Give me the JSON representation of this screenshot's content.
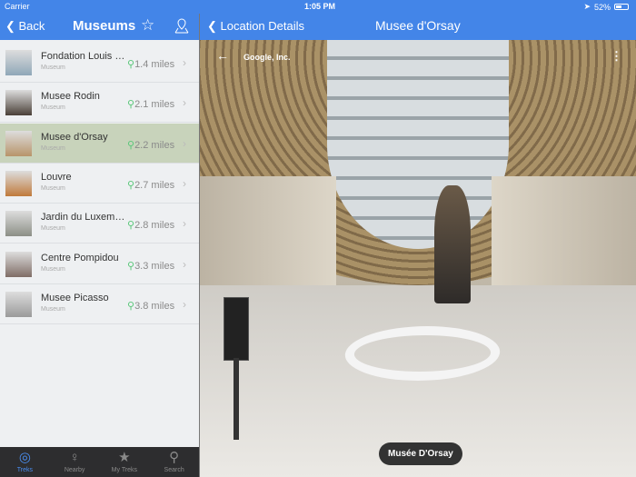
{
  "status": {
    "carrier": "Carrier",
    "time": "1:05 PM",
    "battery": "52%",
    "battery_level": 0.52
  },
  "left_nav": {
    "back": "Back",
    "title": "Museums"
  },
  "museums": [
    {
      "name": "Fondation Louis V...",
      "type": "Museum",
      "distance": "1.4 miles",
      "thumb": "#8fa7b8"
    },
    {
      "name": "Musee Rodin",
      "type": "Museum",
      "distance": "2.1 miles",
      "thumb": "#4a4038"
    },
    {
      "name": "Musee d'Orsay",
      "type": "Museum",
      "distance": "2.2 miles",
      "thumb": "#b8946a",
      "selected": true
    },
    {
      "name": "Louvre",
      "type": "Museum",
      "distance": "2.7 miles",
      "thumb": "#c07a3c"
    },
    {
      "name": "Jardin du Luxemb...",
      "type": "Museum",
      "distance": "2.8 miles",
      "thumb": "#8c8f86"
    },
    {
      "name": "Centre Pompidou",
      "type": "Museum",
      "distance": "3.3 miles",
      "thumb": "#7f6d66"
    },
    {
      "name": "Musee Picasso",
      "type": "Museum",
      "distance": "3.8 miles",
      "thumb": "#9a9a9a"
    }
  ],
  "tabs": [
    {
      "label": "Treks",
      "icon": "treks-icon",
      "active": true
    },
    {
      "label": "Nearby",
      "icon": "pin-icon"
    },
    {
      "label": "My Treks",
      "icon": "star-icon"
    },
    {
      "label": "Search",
      "icon": "search-icon"
    }
  ],
  "right_nav": {
    "back": "Location Details",
    "title": "Musee d'Orsay"
  },
  "streetview": {
    "attribution": "Google, Inc.",
    "place_label": "Musée D'Orsay"
  },
  "colors": {
    "accent": "#4385e8",
    "selected_row": "#c8d3bb",
    "distance_pin": "#5ac77a"
  }
}
